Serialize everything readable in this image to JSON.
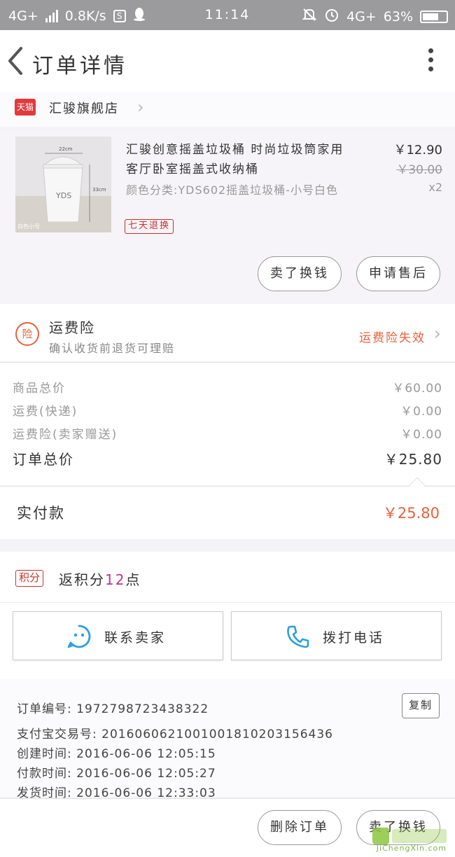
{
  "status_bar": {
    "network": "4G+",
    "speed": "0.8K/s",
    "time": "11:14",
    "network_right": "4G+",
    "battery": "63%"
  },
  "nav": {
    "title": "订单详情"
  },
  "shop": {
    "badge": "天猫",
    "name": "汇骏旗舰店"
  },
  "item": {
    "title": "汇骏创意摇盖垃圾桶 时尚垃圾筒家用客厅卧室摇盖式收纳桶",
    "sku": "颜色分类:YDS602摇盖垃圾桶-小号白色",
    "price": "￥12.90",
    "original_price": "￥30.00",
    "quantity": "x2",
    "tag": "七天退换",
    "image_text": {
      "brand": "YDS",
      "width": "22cm",
      "height": "33cm",
      "caption": "白色小号"
    },
    "buttons": {
      "sell": "卖了换钱",
      "after_sale": "申请售后"
    }
  },
  "insurance": {
    "icon": "险",
    "title": "运费险",
    "subtitle": "确认收货前退货可理赔",
    "status": "运费险失效"
  },
  "costs": [
    {
      "label": "商品总价",
      "value": "￥60.00"
    },
    {
      "label": "运费(快递)",
      "value": "￥0.00"
    },
    {
      "label": "运费险(卖家赠送)",
      "value": "￥0.00"
    },
    {
      "label": "订单总价",
      "value": "￥25.80"
    }
  ],
  "paid": {
    "label": "实付款",
    "value": "￥25.80"
  },
  "points": {
    "tag": "积分",
    "prefix": "返积分",
    "count": "12",
    "suffix": "点"
  },
  "contact": {
    "seller": "联系卖家",
    "call": "拨打电话"
  },
  "order_info": {
    "copy": "复制",
    "rows": [
      "订单编号: 1972798723438322",
      "支付宝交易号: 2016060621001001810203156436",
      "创建时间: 2016-06-06 12:05:15",
      "付款时间: 2016-06-06 12:05:27",
      "发货时间: 2016-06-06 12:33:03"
    ]
  },
  "bottom": {
    "delete": "删除订单",
    "sell": "卖了换钱"
  },
  "watermark": {
    "text": "JiChengXin.com"
  },
  "colors": {
    "accent": "#e8613a",
    "tag_red": "#c4332b",
    "status_bar": "#9b9b9d",
    "contact_blue": "#2ba0e0"
  }
}
